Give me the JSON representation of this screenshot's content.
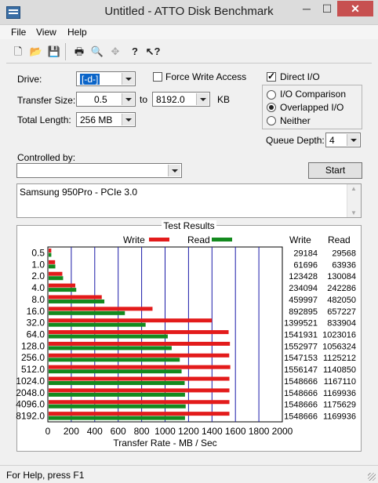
{
  "window": {
    "title": "Untitled - ATTO Disk Benchmark"
  },
  "window_controls": {
    "minimize": "─",
    "maximize": "☐",
    "close": "✕"
  },
  "menu": {
    "items": [
      "File",
      "View",
      "Help"
    ]
  },
  "toolbar": {
    "buttons": [
      {
        "name": "new",
        "glyph": "🗋"
      },
      {
        "name": "open",
        "glyph": "📂"
      },
      {
        "name": "save",
        "glyph": "💾"
      },
      {
        "name": "print",
        "glyph": "🖶"
      },
      {
        "name": "print-preview",
        "glyph": "🔍"
      },
      {
        "name": "move",
        "glyph": "✥"
      },
      {
        "name": "about",
        "glyph": "?"
      },
      {
        "name": "context-help",
        "glyph": "↖?"
      }
    ]
  },
  "form": {
    "drive_label": "Drive:",
    "drive_value": "[-d-]",
    "force_write_label": "Force Write Access",
    "force_write_checked": false,
    "direct_io_label": "Direct I/O",
    "direct_io_checked": true,
    "transfer_size_label": "Transfer Size:",
    "transfer_from": "0.5",
    "to_label": "to",
    "transfer_to": "8192.0",
    "kb_label": "KB",
    "total_length_label": "Total Length:",
    "total_length_value": "256 MB",
    "io_options": [
      {
        "label": "I/O Comparison",
        "selected": false
      },
      {
        "label": "Overlapped I/O",
        "selected": true
      },
      {
        "label": "Neither",
        "selected": false
      }
    ],
    "queue_depth_label": "Queue Depth:",
    "queue_depth_value": "4",
    "controlled_by_label": "Controlled by:",
    "controlled_by_value": "",
    "start_label": "Start",
    "description": "Samsung 950Pro - PCIe 3.0"
  },
  "colors": {
    "write": "#e31b1b",
    "read": "#138a1e",
    "grid": "#1a1aa8"
  },
  "results": {
    "title": "Test Results",
    "legend_write": "Write",
    "legend_read": "Read",
    "col_write": "Write",
    "col_read": "Read"
  },
  "chart_data": {
    "type": "bar",
    "orientation": "horizontal",
    "title": "Test Results",
    "xlabel": "Transfer Rate - MB / Sec",
    "xlim": [
      0,
      2000
    ],
    "xticks": [
      0,
      200,
      400,
      600,
      800,
      1000,
      1200,
      1400,
      1600,
      1800,
      2000
    ],
    "categories": [
      "0.5",
      "1.0",
      "2.0",
      "4.0",
      "8.0",
      "16.0",
      "32.0",
      "64.0",
      "128.0",
      "256.0",
      "512.0",
      "1024.0",
      "2048.0",
      "4096.0",
      "8192.0"
    ],
    "series": [
      {
        "name": "Write",
        "values": [
          29184,
          61696,
          123428,
          234094,
          459997,
          892895,
          1399521,
          1541931,
          1552977,
          1547153,
          1556147,
          1548666,
          1548666,
          1548666,
          1548666
        ]
      },
      {
        "name": "Read",
        "values": [
          29568,
          63936,
          130084,
          242286,
          482050,
          657227,
          833904,
          1023016,
          1056324,
          1125212,
          1140850,
          1167110,
          1169936,
          1175629,
          1169936
        ]
      }
    ]
  },
  "status": {
    "text": "For Help, press F1"
  }
}
